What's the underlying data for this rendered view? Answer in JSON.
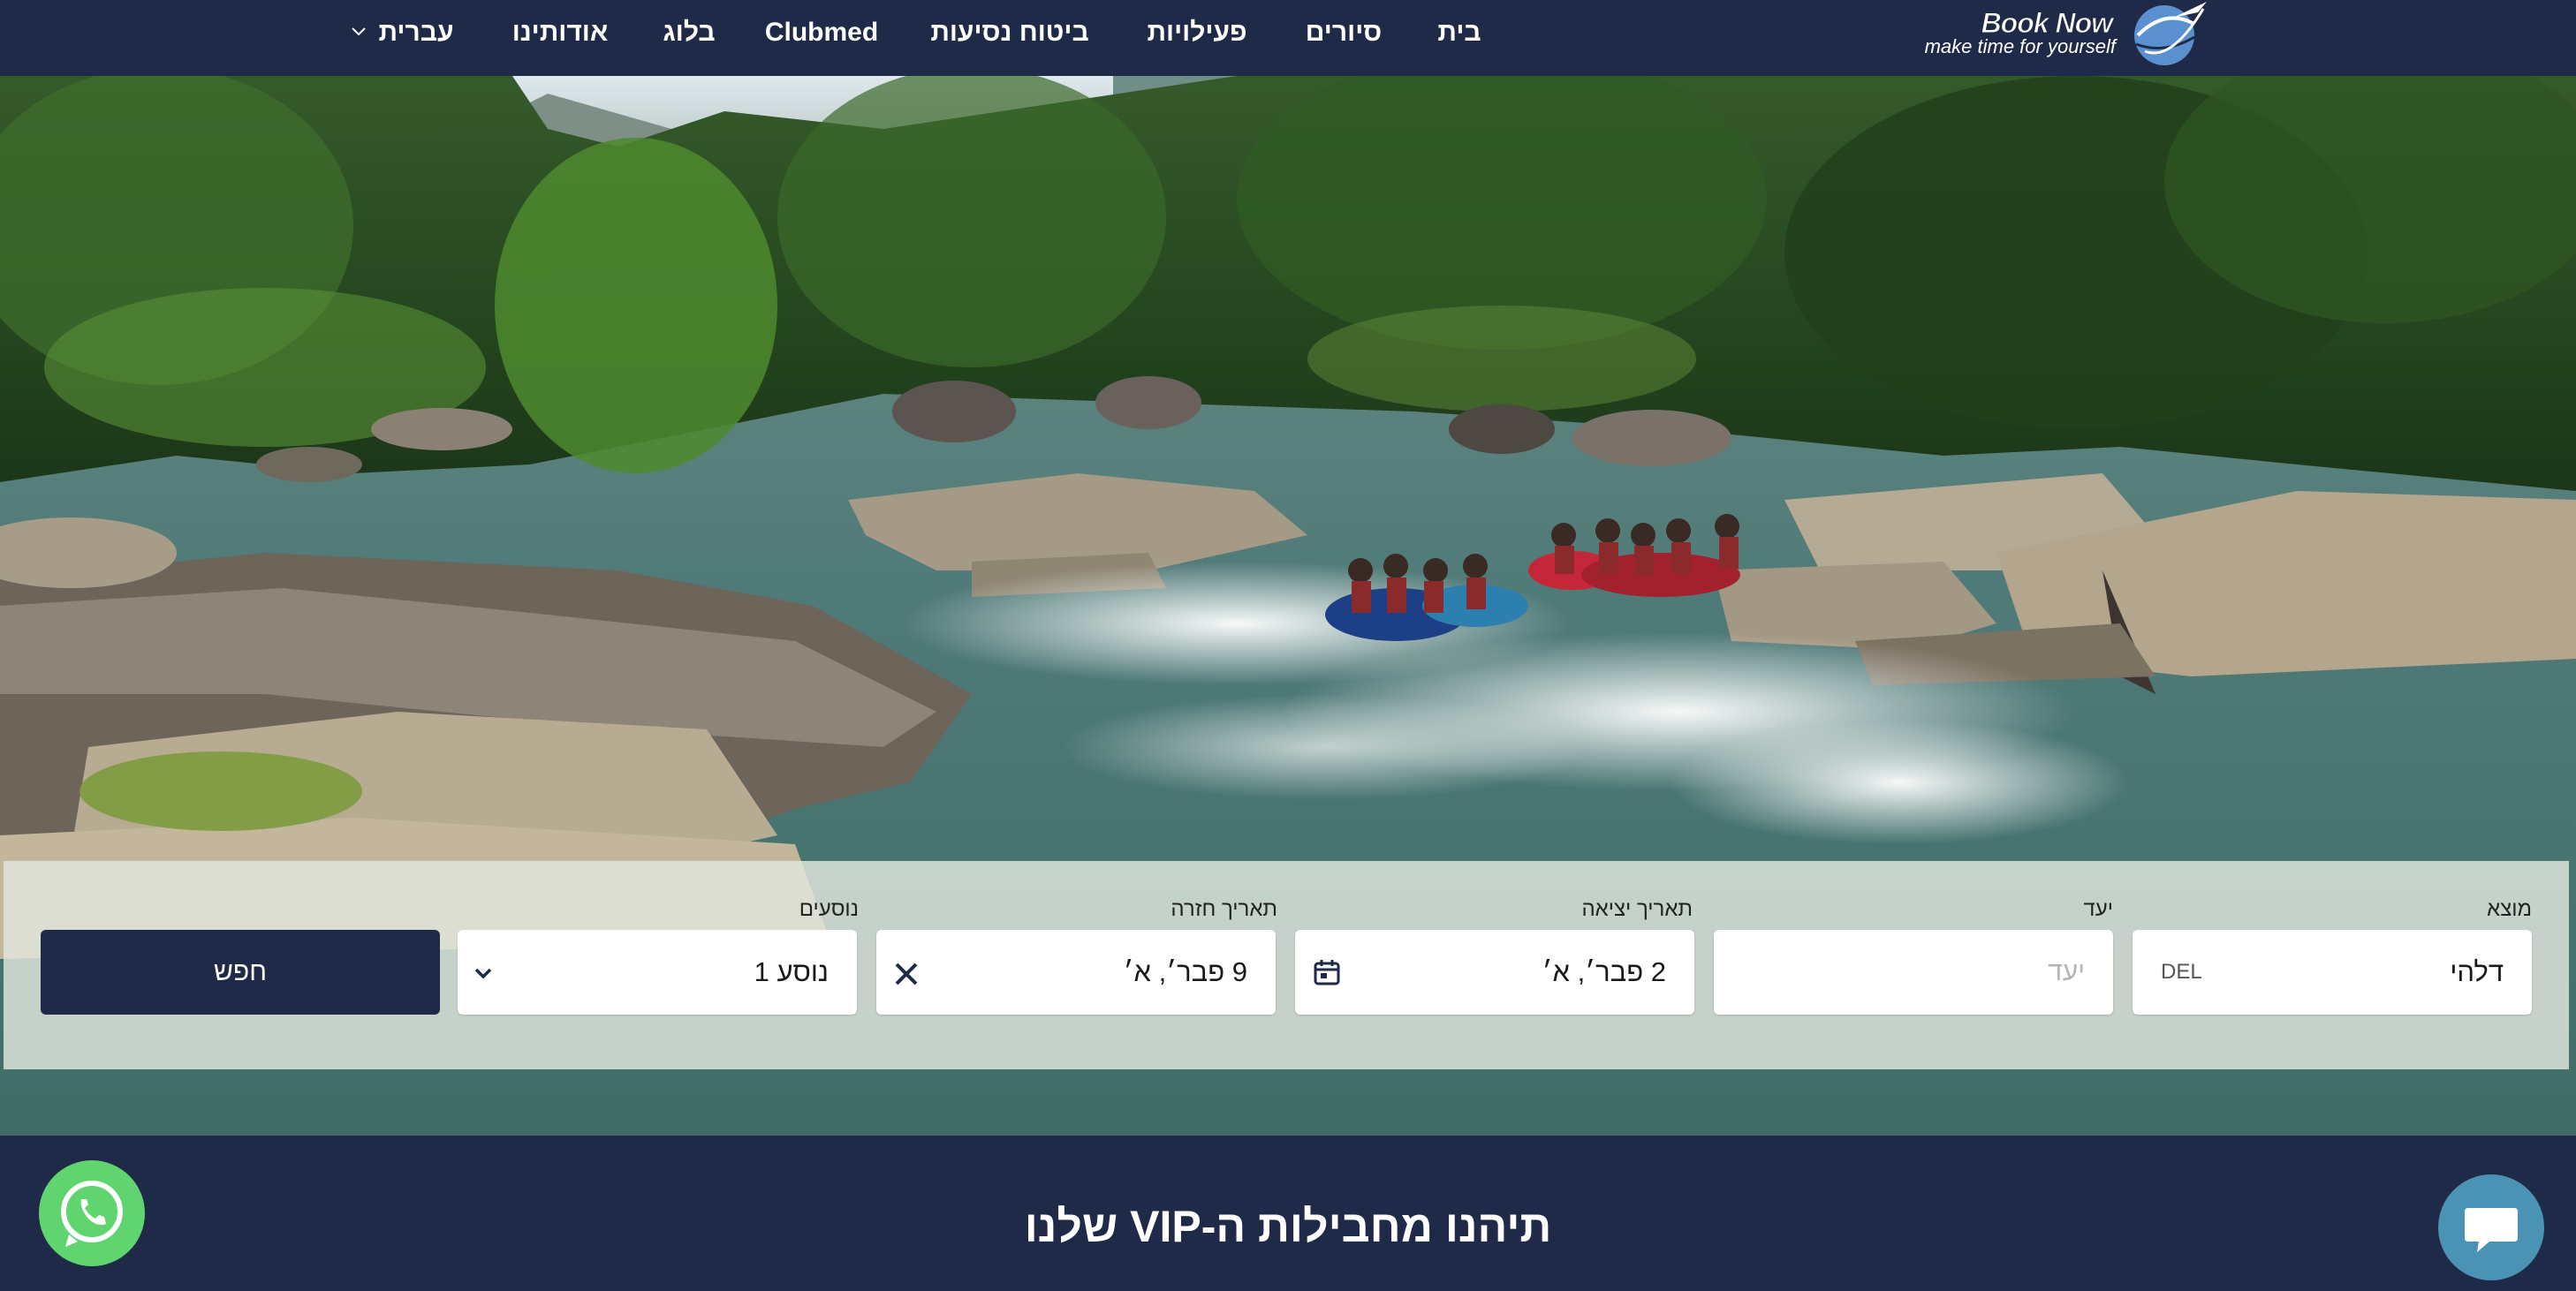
{
  "nav": {
    "items": [
      {
        "label": "בית"
      },
      {
        "label": "סיורים"
      },
      {
        "label": "פעילויות"
      },
      {
        "label": "ביטוח נסיעות"
      },
      {
        "label": "Clubmed"
      },
      {
        "label": "בלוג"
      },
      {
        "label": "אודותינו"
      },
      {
        "label": "עברית"
      }
    ]
  },
  "logo": {
    "title": "Book Now",
    "tagline": "make time for yourself"
  },
  "search": {
    "origin": {
      "label": "מוצא",
      "value": "דלהי",
      "code": "DEL"
    },
    "destination": {
      "label": "יעד",
      "placeholder": "יעד"
    },
    "depart": {
      "label": "תאריך יציאה",
      "value": "2 פבר׳, א׳"
    },
    "return": {
      "label": "תאריך חזרה",
      "value": "9 פבר׳, א׳"
    },
    "passengers": {
      "label": "נוסעים",
      "value": "נוסע 1"
    },
    "button": "חפש"
  },
  "section": {
    "title": "תיהנו מחבילות ה-VIP שלנו"
  },
  "colors": {
    "navy": "#1e2a47",
    "whatsapp": "#5fd46f",
    "chat": "#4a93b5"
  },
  "icons": {
    "calendar": "calendar-icon",
    "clear": "close-icon",
    "dropdown": "chevron-down-icon",
    "whatsapp": "whatsapp-icon",
    "chat": "chat-icon",
    "logo": "plane-globe-icon"
  }
}
